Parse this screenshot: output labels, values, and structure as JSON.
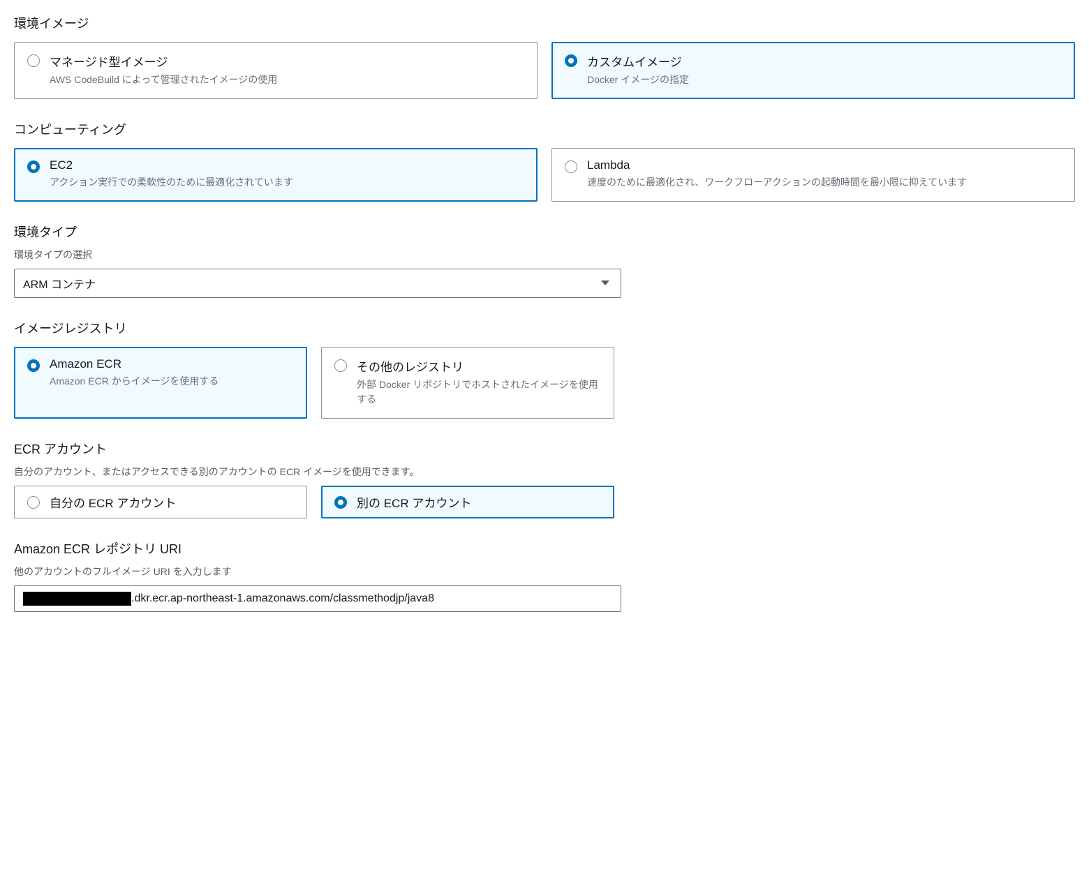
{
  "environmentImage": {
    "heading": "環境イメージ",
    "options": [
      {
        "title": "マネージド型イメージ",
        "desc": "AWS CodeBuild によって管理されたイメージの使用",
        "selected": false
      },
      {
        "title": "カスタムイメージ",
        "desc": "Docker イメージの指定",
        "selected": true
      }
    ]
  },
  "computing": {
    "heading": "コンピューティング",
    "options": [
      {
        "title": "EC2",
        "desc": "アクション実行での柔軟性のために最適化されています",
        "selected": true
      },
      {
        "title": "Lambda",
        "desc": "速度のために最適化され、ワークフローアクションの起動時間を最小限に抑えています",
        "selected": false
      }
    ]
  },
  "environmentType": {
    "heading": "環境タイプ",
    "subtitle": "環境タイプの選択",
    "value": "ARM コンテナ"
  },
  "imageRegistry": {
    "heading": "イメージレジストリ",
    "options": [
      {
        "title": "Amazon ECR",
        "desc": "Amazon ECR からイメージを使用する",
        "selected": true
      },
      {
        "title": "その他のレジストリ",
        "desc": "外部 Docker リポジトリでホストされたイメージを使用する",
        "selected": false
      }
    ]
  },
  "ecrAccount": {
    "heading": "ECR アカウント",
    "subtitle": "自分のアカウント、またはアクセスできる別のアカウントの ECR イメージを使用できます。",
    "options": [
      {
        "label": "自分の ECR アカウント",
        "selected": false
      },
      {
        "label": "別の ECR アカウント",
        "selected": true
      }
    ]
  },
  "ecrRepoUri": {
    "heading": "Amazon ECR レポジトリ URI",
    "subtitle": "他のアカウントのフルイメージ URI を入力します",
    "valueSuffix": ".dkr.ecr.ap-northeast-1.amazonaws.com/classmethodjp/java8"
  }
}
